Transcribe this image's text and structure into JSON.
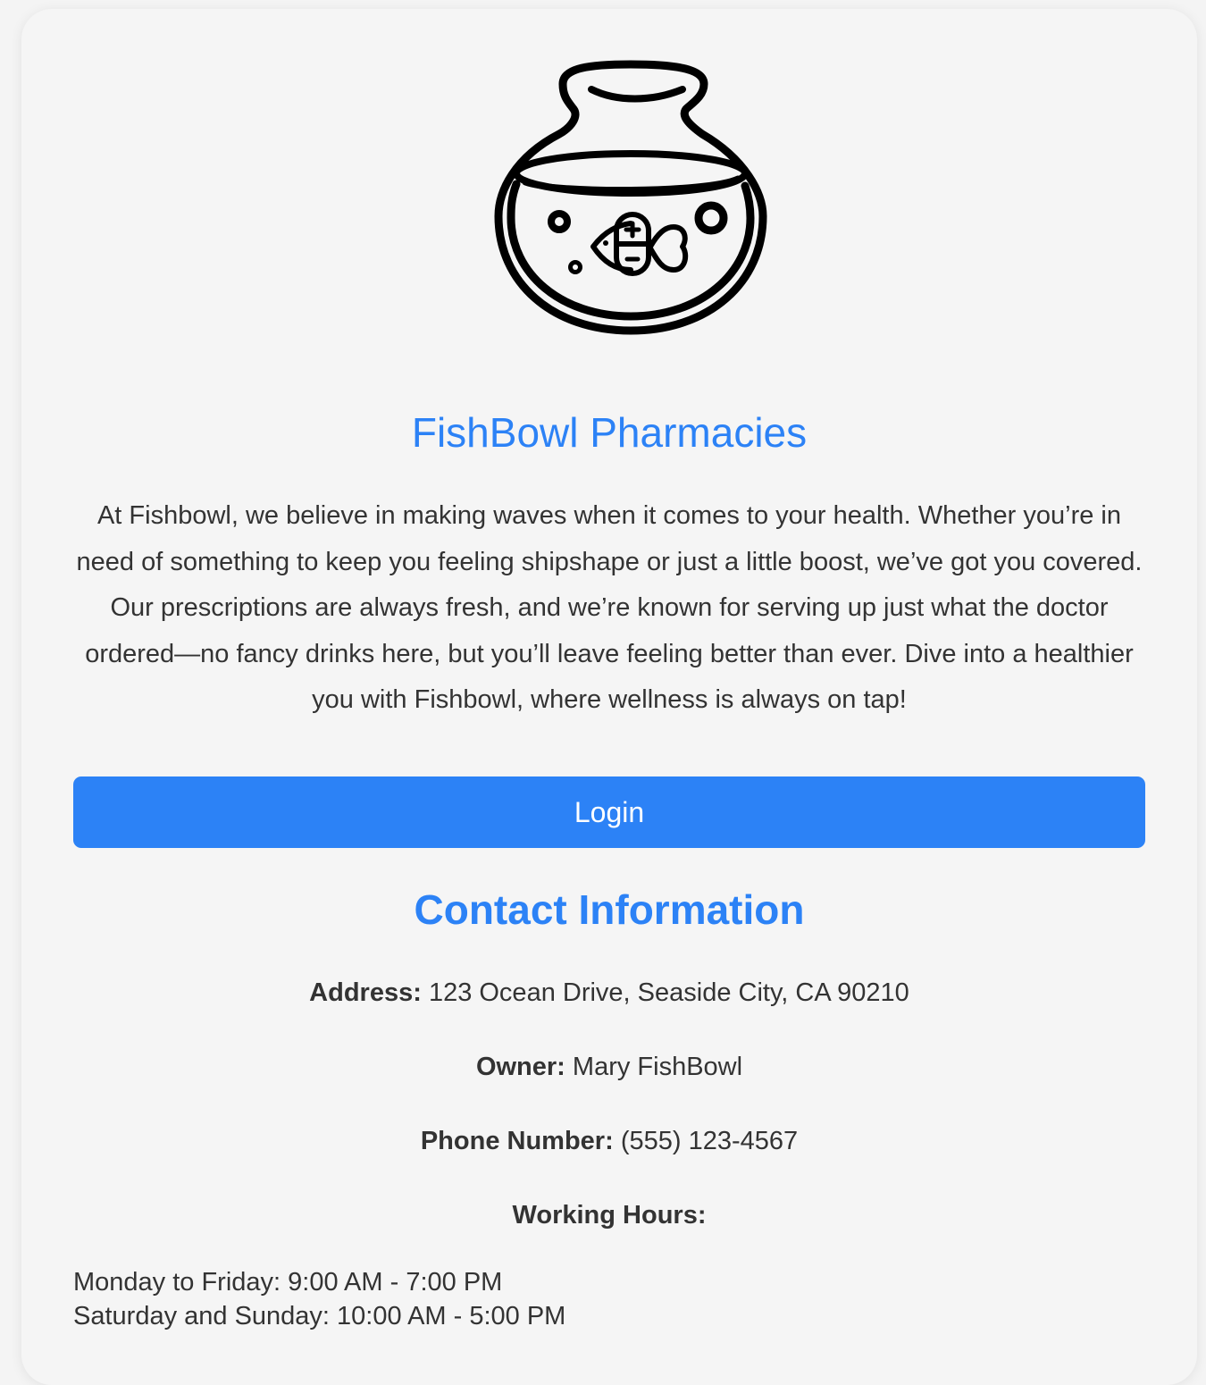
{
  "brand": {
    "logo_icon": "fishbowl-pill-fish-icon",
    "title": "FishBowl Pharmacies"
  },
  "intro": {
    "text": "At Fishbowl, we believe in making waves when it comes to your health. Whether you’re in need of something to keep you feeling shipshape or just a little boost, we’ve got you covered. Our prescriptions are always fresh, and we’re known for serving up just what the doctor ordered—no fancy drinks here, but you’ll leave feeling better than ever. Dive into a healthier you with Fishbowl, where wellness is always on tap!"
  },
  "actions": {
    "login_label": "Login"
  },
  "contact": {
    "title": "Contact Information",
    "address_label": "Address:",
    "address_value": "123 Ocean Drive, Seaside City, CA 90210",
    "owner_label": "Owner:",
    "owner_value": "Mary FishBowl",
    "phone_label": "Phone Number:",
    "phone_value": "(555) 123-4567",
    "hours_label": "Working Hours:",
    "hours": [
      "Monday to Friday: 9:00 AM - 7:00 PM",
      "Saturday and Sunday: 10:00 AM - 5:00 PM"
    ]
  },
  "colors": {
    "accent": "#2c82f6",
    "text": "#333333",
    "card_background": "#f5f5f5"
  }
}
